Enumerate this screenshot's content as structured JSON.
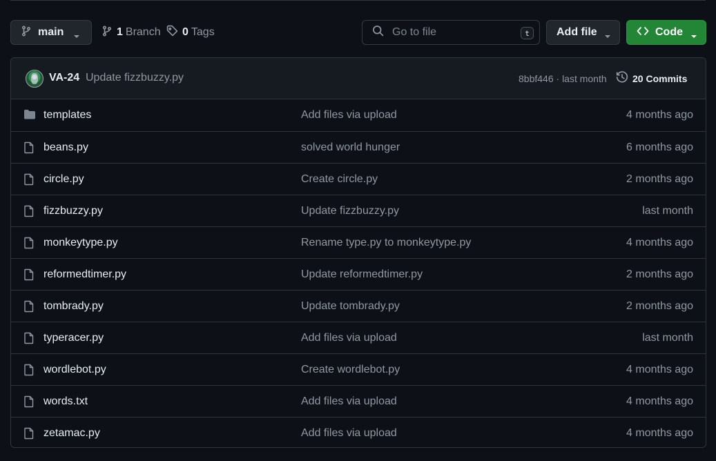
{
  "branch": {
    "name": "main",
    "icon": "git-branch-icon"
  },
  "branches": {
    "count": "1",
    "label": "Branch"
  },
  "tags": {
    "count": "0",
    "label": "Tags"
  },
  "search": {
    "placeholder": "Go to file",
    "shortcut": "t"
  },
  "add_file": {
    "label": "Add file"
  },
  "code": {
    "label": "Code",
    "color": "#238636"
  },
  "latest_commit": {
    "author": "VA-24",
    "message": "Update fizzbuzzy.py",
    "sha": "8bbf446",
    "time": "last month",
    "commits_count": "20",
    "commits_label": "Commits"
  },
  "files": [
    {
      "type": "folder",
      "icon": "folder-icon",
      "name": "templates",
      "message": "Add files via upload",
      "date": "4 months ago"
    },
    {
      "type": "file",
      "icon": "file-icon",
      "name": "beans.py",
      "message": "solved world hunger",
      "date": "6 months ago"
    },
    {
      "type": "file",
      "icon": "file-icon",
      "name": "circle.py",
      "message": "Create circle.py",
      "date": "2 months ago"
    },
    {
      "type": "file",
      "icon": "file-icon",
      "name": "fizzbuzzy.py",
      "message": "Update fizzbuzzy.py",
      "date": "last month"
    },
    {
      "type": "file",
      "icon": "file-icon",
      "name": "monkeytype.py",
      "message": "Rename type.py to monkeytype.py",
      "date": "4 months ago"
    },
    {
      "type": "file",
      "icon": "file-icon",
      "name": "reformedtimer.py",
      "message": "Update reformedtimer.py",
      "date": "2 months ago"
    },
    {
      "type": "file",
      "icon": "file-icon",
      "name": "tombrady.py",
      "message": "Update tombrady.py",
      "date": "2 months ago"
    },
    {
      "type": "file",
      "icon": "file-icon",
      "name": "typeracer.py",
      "message": "Add files via upload",
      "date": "last month"
    },
    {
      "type": "file",
      "icon": "file-icon",
      "name": "wordlebot.py",
      "message": "Create wordlebot.py",
      "date": "4 months ago"
    },
    {
      "type": "file",
      "icon": "file-icon",
      "name": "words.txt",
      "message": "Add files via upload",
      "date": "4 months ago"
    },
    {
      "type": "file",
      "icon": "file-icon",
      "name": "zetamac.py",
      "message": "Add files via upload",
      "date": "4 months ago"
    }
  ]
}
